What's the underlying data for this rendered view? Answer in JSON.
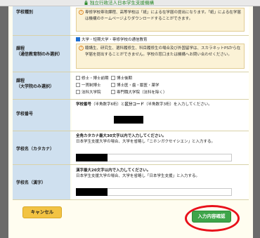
{
  "window": {
    "title": "独立行政法人日本学生支援機構"
  },
  "rows": {
    "school_type": {
      "label": "学校種別",
      "note": "専修学校専攻課程、高等学校は「紙」による在学届の提出になります。「紙」による在学届は機構のホームページよりダウンロードすることができます。"
    },
    "course": {
      "label_line1": "課程",
      "label_line2": "（通信教育制のみ選択）",
      "checkbox_label": "大学・短期大学・専修学校の通信教育",
      "checkbox_checked": true,
      "note": "聴講生、研究生、選科履修生、科目履修生の場合及び外国留学は、スカラネットPSから在学届を提出することができません。学校の窓口または機構へお問い合わせください。"
    },
    "program": {
      "label_line1": "課程",
      "label_line2": "（大学院のみ選択）",
      "options": [
        "修士・博士前期",
        "博士後期",
        "一貫制博士",
        "博士医・歯・獣医・薬学",
        "法科大学院",
        "専門職大学院（法科を除く）"
      ]
    },
    "school_number": {
      "label": "学校番号",
      "line1_bold": "学校番号",
      "line1_mid": "（半角数字6桁）と",
      "line1_bold2": "区分コード",
      "line1_end": "（半角数字3桁）を入力してください。"
    },
    "school_kana": {
      "label": "学校名（カタカナ）",
      "line1": "全角カタカナ最大30文字以内で入力してください。",
      "line2": "日本学生支援大学の場合、大学を省略し「ニホンガクセイシエン」と入力する。"
    },
    "school_kanji": {
      "label": "学校名（漢字）",
      "line1": "漢字最大20文字以内で入力してください。",
      "line2": "日本学生支援大学の場合、大学を省略し「日本学生支援」と入力する。"
    }
  },
  "buttons": {
    "cancel": "キャンセル",
    "confirm": "入力内容確認"
  }
}
